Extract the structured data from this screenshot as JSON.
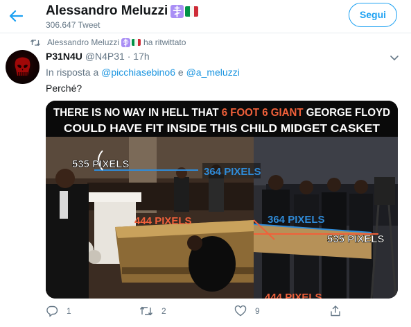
{
  "header": {
    "profile_name": "Alessandro Meluzzi",
    "tweet_count": "306.647 Tweet",
    "follow_label": "Segui"
  },
  "retweet": {
    "retweeter": "Alessandro Meluzzi",
    "label": "ha ritwittato"
  },
  "tweet": {
    "display_name": "P31N4U",
    "handle": "@N4P31",
    "separator": "·",
    "time": "17h",
    "reply_prefix": "In risposta a",
    "reply_mention_1": "@picchiasebino6",
    "reply_conj": "e",
    "reply_mention_2": "@a_meluzzi",
    "text": "Perché?"
  },
  "image": {
    "caption_line1_part1": "THERE IS NO WAY IN HELL THAT ",
    "caption_line1_highlight": "6 FOOT 6 GIANT",
    "caption_line1_part2": " GEORGE FLOYD",
    "caption_line2": "COULD HAVE FIT INSIDE THIS CHILD MIDGET CASKET",
    "labels": [
      "535 PIXELS",
      "364 PIXELS",
      "444 PIXELS",
      "364 PIXELS",
      "535 PIXELS",
      "444 PIXELS"
    ],
    "caption_highlight_color": "#f0603a",
    "label_blue": "#2f8bd8",
    "label_red": "#f0603a"
  },
  "actions": {
    "reply_count": "1",
    "retweet_count": "2",
    "like_count": "9",
    "accent_color": "#1da1f2"
  }
}
